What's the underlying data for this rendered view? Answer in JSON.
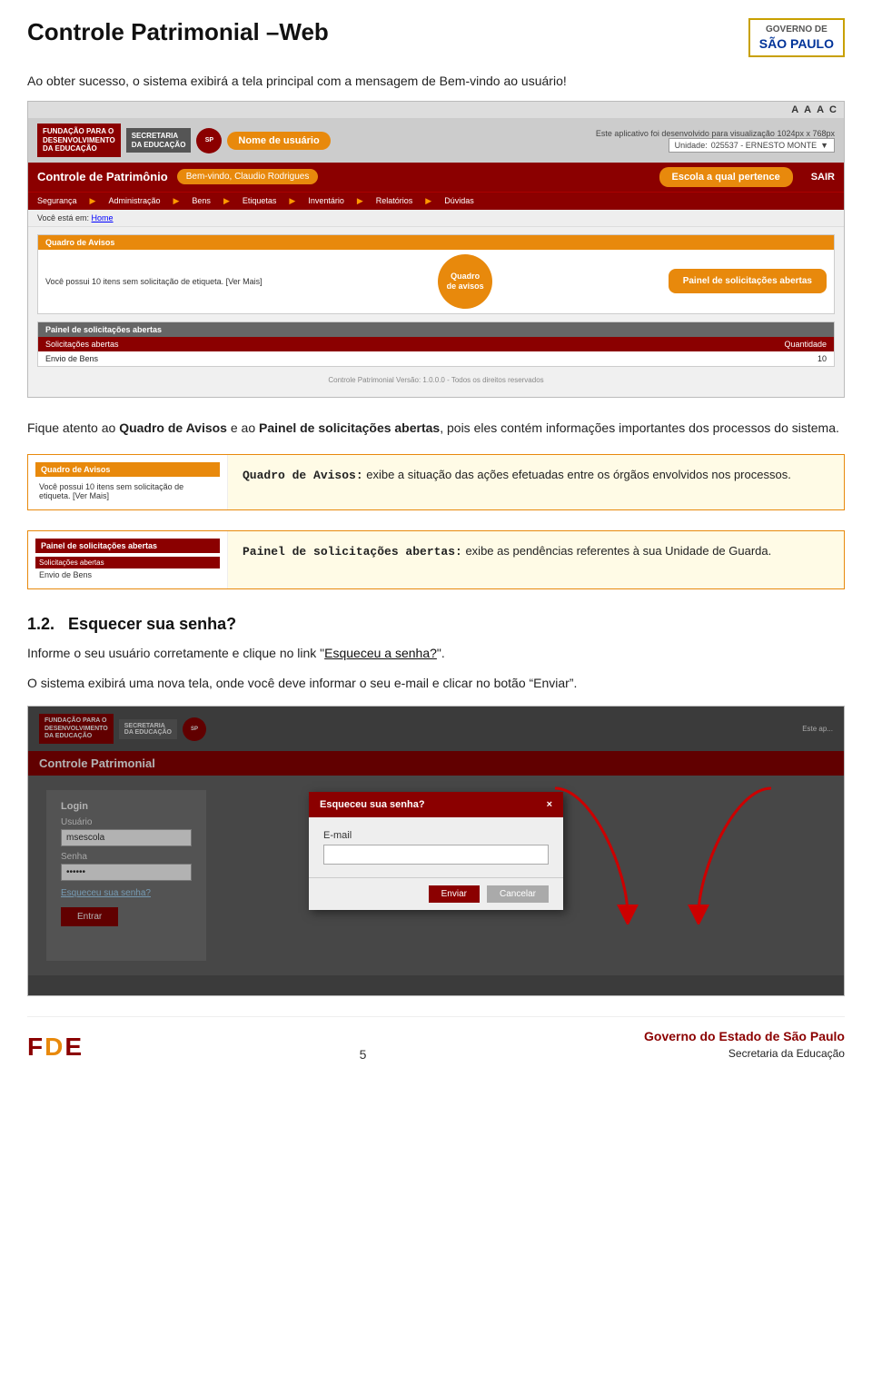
{
  "header": {
    "title": "Controle Patrimonial –Web",
    "gov_logo_line1": "GOVERNO DE",
    "gov_logo_line2": "SÃO PAULO"
  },
  "intro": {
    "text": "Ao obter sucesso, o sistema exibirá a tela principal com a mensagem de Bem-vindo ao usuário!"
  },
  "main_screenshot": {
    "top_bar": {
      "labels": [
        "A",
        "A",
        "A",
        "C"
      ]
    },
    "header": {
      "logo1_line1": "FUNDAÇÃO PARA O",
      "logo1_line2": "DESENVOLVIMENTO",
      "logo1_line3": "DA EDUCAÇÃO",
      "logo2_line1": "SECRETARIA",
      "logo2_line2": "DA EDUCAÇÃO",
      "note": "Este aplicativo foi desenvolvido para visualização 1024px x 768px",
      "unidade_label": "Unidade:",
      "unidade_value": "025537 - ERNESTO MONTE",
      "username_bubble": "Nome de usuário"
    },
    "title_bar": {
      "title": "Controle de Patrimônio",
      "bemvindo": "Bem-vindo, Claudio Rodrigues",
      "escola": "Escola a qual pertence",
      "sair": "SAIR"
    },
    "nav": {
      "items": [
        "Segurança",
        "Administração",
        "Bens",
        "Etiquetas",
        "Inventário",
        "Relatórios",
        "Dúvidas"
      ]
    },
    "breadcrumb": "Você está em: Home",
    "quadro_avisos": {
      "header": "Quadro de Avisos",
      "text": "Você possui 10 itens sem solicitação de etiqueta. [Ver Mais]",
      "bubble": "Quadro\nde avisos"
    },
    "painel": {
      "header": "Painel de solicitações abertas",
      "bubble": "Painel de solicitações abertas",
      "table_header": [
        "Solicitações abertas",
        "Quantidade"
      ],
      "row": [
        "Envio de Bens",
        "10"
      ]
    },
    "footer_text": "Controle Patrimonial Versão: 1.0.0.0 - Todos os direitos reservados"
  },
  "explain": {
    "text_before_bold1": "Fique atento ao ",
    "bold1": "Quadro de Avisos",
    "text_between": " e ao ",
    "bold2": "Painel de solicitações abertas",
    "text_after": ", pois eles contém informações importantes dos processos do sistema."
  },
  "quadro_info": {
    "panel_header": "Quadro de Avisos",
    "panel_text": "Você possui 10 itens sem solicitação de etiqueta. [Ver Mais]",
    "description_bold": "Quadro de Avisos:",
    "description_text": " exibe a situação das ações efetuadas entre os órgãos envolvidos nos processos."
  },
  "painel_info": {
    "panel_header": "Painel de solicitações abertas",
    "table_header_sol": "Solicitações abertas",
    "table_header_qtd": "Quantidade",
    "row_text": "Envio de Bens",
    "description_bold": "Painel de solicitações abertas:",
    "description_text": " exibe as pendências referentes à sua Unidade de Guarda."
  },
  "section12": {
    "number": "1.2.",
    "title": "Esquecer sua senha?",
    "text1": "Informe o seu usuário corretamente e clique no link “Esqueceu a senha?”.",
    "link_text": "Esqueceu a senha?",
    "text2": "O sistema exibirá uma nova tela, onde você deve informar o seu e-mail e clicar no botão “Enviar”."
  },
  "login_screenshot": {
    "logo1_line1": "FUNDAÇÃO PARA O",
    "logo1_line2": "DESENVOLVIMENTO",
    "logo1_line3": "DA EDUCAÇÃO",
    "logo2": "SECRETARIA\nDA EDUCAÇÃO",
    "note": "Este ap...",
    "title": "Controle Patrimonial",
    "form_title": "Login",
    "user_label": "Usuário",
    "user_value": "msescola",
    "pass_label": "Senha",
    "forgot_link": "Esqueceu sua senha?",
    "btn_entrar": "Entrar",
    "modal_title": "Esqueceu sua senha?",
    "modal_close": "×",
    "email_label": "E-mail",
    "btn_send": "Enviar",
    "btn_cancel": "Cancelar"
  },
  "page_footer": {
    "page_number": "5",
    "gov_line1": "Governo do Estado de São Paulo",
    "gov_line2": "Secretaria da Educação",
    "fde_f": "F",
    "fde_d": "D",
    "fde_e": "E"
  }
}
